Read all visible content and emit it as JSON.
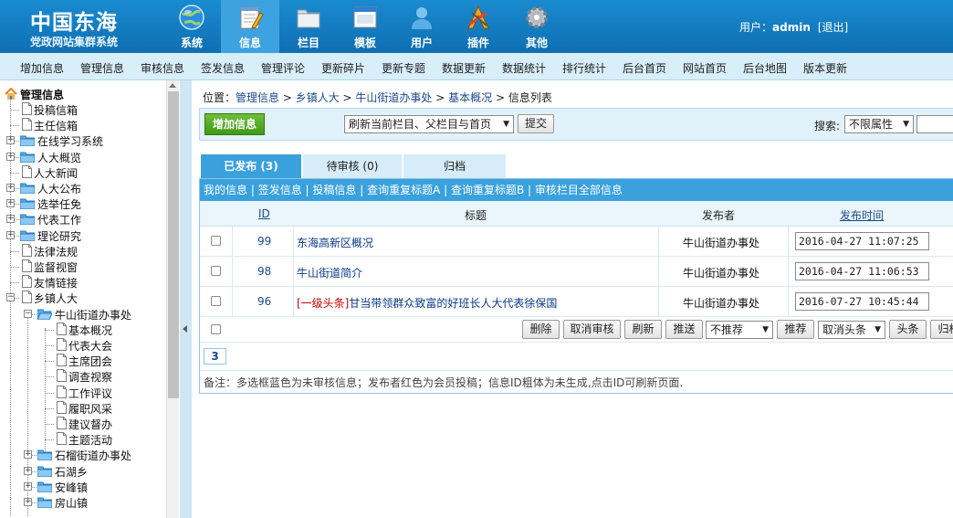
{
  "header": {
    "title": "中国东海",
    "subtitle": "党政网站集群系统",
    "nav": [
      {
        "label": "系统",
        "icon": "globe-icon"
      },
      {
        "label": "信息",
        "icon": "notepad-icon"
      },
      {
        "label": "栏目",
        "icon": "folder-icon"
      },
      {
        "label": "模板",
        "icon": "window-icon"
      },
      {
        "label": "用户",
        "icon": "user-icon"
      },
      {
        "label": "插件",
        "icon": "tools-icon"
      },
      {
        "label": "其他",
        "icon": "gear-icon"
      }
    ],
    "active_nav": "信息",
    "user_label": "用户：",
    "username": "admin",
    "logout": "[退出]"
  },
  "menu": [
    "增加信息",
    "管理信息",
    "审核信息",
    "签发信息",
    "管理评论",
    "更新碎片",
    "更新专题",
    "数据更新",
    "数据统计",
    "排行统计",
    "后台首页",
    "网站首页",
    "后台地图",
    "版本更新"
  ],
  "tree": {
    "root": "管理信息",
    "items": [
      {
        "label": "投稿信箱"
      },
      {
        "label": "主任信箱"
      },
      {
        "label": "在线学习系统"
      },
      {
        "label": "人大概览"
      },
      {
        "label": "人大新闻"
      },
      {
        "label": "人大公布"
      },
      {
        "label": "选举任免"
      },
      {
        "label": "代表工作"
      },
      {
        "label": "理论研究"
      },
      {
        "label": "法律法规"
      },
      {
        "label": "监督视窗"
      },
      {
        "label": "友情链接"
      },
      {
        "label": "乡镇人大"
      },
      {
        "label": "牛山街道办事处"
      },
      {
        "label": "基本概况"
      },
      {
        "label": "代表大会"
      },
      {
        "label": "主席团会"
      },
      {
        "label": "调查视察"
      },
      {
        "label": "工作评议"
      },
      {
        "label": "履职风采"
      },
      {
        "label": "建议督办"
      },
      {
        "label": "主题活动"
      },
      {
        "label": "石榴街道办事处"
      },
      {
        "label": "石湖乡"
      },
      {
        "label": "安峰镇"
      },
      {
        "label": "房山镇"
      }
    ]
  },
  "breadcrumb": {
    "prefix": "位置：",
    "items": [
      "管理信息",
      "乡镇人大",
      "牛山街道办事处",
      "基本概况",
      "信息列表"
    ],
    "sep": " > "
  },
  "toolbar": {
    "add_label": "增加信息",
    "refresh_select": "刷新当前栏目、父栏目与首页",
    "submit": "提交",
    "search_label": "搜索:",
    "search_select": "不限属性"
  },
  "tabs": [
    "已发布 (3)",
    "待审核 (0)",
    "归档"
  ],
  "subnav": [
    "我的信息",
    "签发信息",
    "投稿信息",
    "查询重复标题A",
    "查询重复标题B",
    "审核栏目全部信息"
  ],
  "table": {
    "headers": {
      "id": "ID",
      "title": "标题",
      "publisher": "发布者",
      "time": "发布时间"
    },
    "rows": [
      {
        "id": "99",
        "tag": "",
        "title": "东海高新区概况",
        "publisher": "牛山街道办事处",
        "time": "2016-04-27 11:07:25"
      },
      {
        "id": "98",
        "tag": "",
        "title": "牛山街道简介",
        "publisher": "牛山街道办事处",
        "time": "2016-04-27 11:06:53"
      },
      {
        "id": "96",
        "tag": "[一级头条]",
        "title": "甘当带领群众致富的好班长人大代表徐保国",
        "publisher": "牛山街道办事处",
        "time": "2016-07-27 10:45:44"
      }
    ]
  },
  "actions": {
    "delete": "删除",
    "cancel_review": "取消审核",
    "refresh": "刷新",
    "push": "推送",
    "recommend_select": "不推荐",
    "recommend": "推荐",
    "headline_select": "取消头条",
    "headline": "头条",
    "archive": "归档"
  },
  "pager": "3",
  "note": "备注：多选框蓝色为未审核信息；发布者红色为会员投稿；信息ID粗体为未生成,点击ID可刷新页面."
}
